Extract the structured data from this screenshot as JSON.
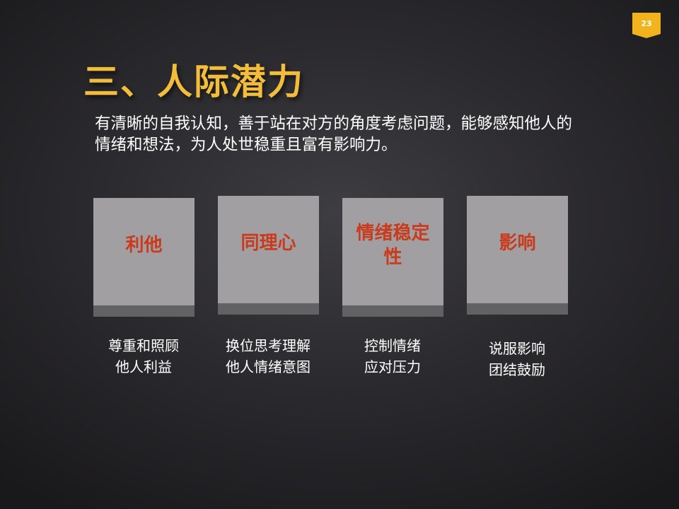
{
  "slide": {
    "page_number": "23",
    "title": "三、人际潜力",
    "intro": "有清晰的自我认知，善于站在对方的角度考虑问题，能够感知他人的情绪和想法，为人处世稳重且富有影响力。"
  },
  "colors": {
    "accent": "#f2b31c",
    "title": "#f3bc3b",
    "card_face": "#a19fa2",
    "card_bar": "#626164",
    "card_label": "#c93b1c"
  },
  "cards": [
    {
      "label": "利他",
      "desc": [
        "尊重和照顾",
        "他人利益"
      ]
    },
    {
      "label": "同理心",
      "desc": [
        "换位思考理解",
        "他人情绪意图"
      ]
    },
    {
      "label": "情绪稳定性",
      "desc": [
        "控制情绪",
        "应对压力"
      ]
    },
    {
      "label": "影响",
      "desc": [
        "说服影响",
        "团结鼓励"
      ]
    }
  ]
}
